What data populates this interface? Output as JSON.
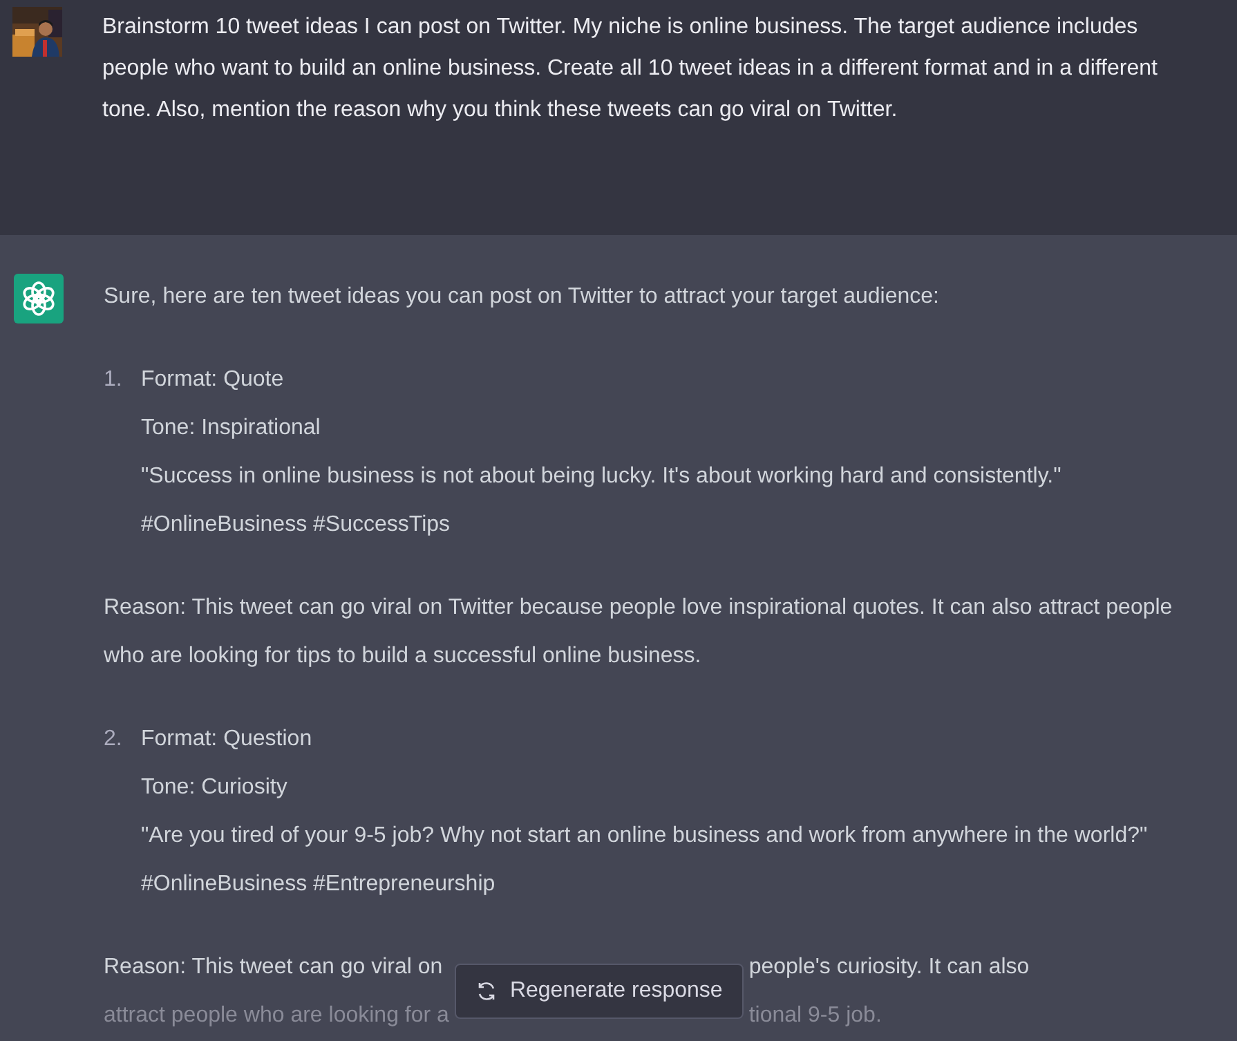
{
  "user_message": {
    "text": "Brainstorm 10 tweet ideas I can post on Twitter. My niche is online business. The target audience includes people who want to build an online business. Create all 10 tweet ideas in a different format and in a different tone. Also, mention the reason why you think these tweets can go viral on Twitter."
  },
  "assistant_message": {
    "intro": "Sure, here are ten tweet ideas you can post on Twitter to attract your target audience:",
    "items": [
      {
        "number": "1.",
        "lines": [
          "Format: Quote",
          "Tone: Inspirational",
          "\"Success in online business is not about being lucky. It's about working hard and consistently.\" #OnlineBusiness #SuccessTips"
        ],
        "reason": "Reason: This tweet can go viral on Twitter because people love inspirational quotes. It can also attract people who are looking for tips to build a successful online business."
      },
      {
        "number": "2.",
        "lines": [
          "Format: Question",
          "Tone: Curiosity",
          "\"Are you tired of your 9-5 job? Why not start an online business and work from anywhere in the world?\" #OnlineBusiness #Entrepreneurship"
        ]
      }
    ],
    "cut_reason": {
      "line_1_start": "Reason: This tweet can go viral on",
      "line_1_end": "people's curiosity. It can also",
      "line_2_start": "attract people who are looking for a",
      "line_2_end": "tional 9-5 job."
    }
  },
  "regenerate_button": {
    "label": "Regenerate response"
  }
}
